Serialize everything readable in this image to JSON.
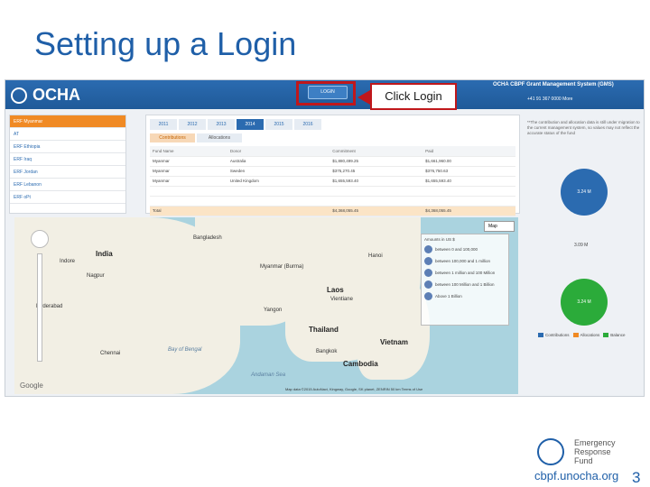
{
  "slide": {
    "title": "Setting up a Login",
    "callout": "Click Login",
    "url": "cbpf.unocha.org",
    "page_number": "3",
    "erf_lines": [
      "Emergency",
      "Response",
      "Fund"
    ]
  },
  "app": {
    "logo_text": "OCHA",
    "login_label": "LOGIN",
    "gms_title": "OCHA CBPF Grant Management System (GMS)",
    "gms_contact": "+41 91 367 0000  More"
  },
  "sidebar": {
    "items": [
      {
        "label": "ERF Myanmar"
      },
      {
        "label": "AT"
      },
      {
        "label": "ERF Ethiopia"
      },
      {
        "label": "ERF Iraq"
      },
      {
        "label": "ERF Jordan"
      },
      {
        "label": "ERF Lebanon"
      },
      {
        "label": "ERF oPt"
      }
    ]
  },
  "content": {
    "years": [
      "2011",
      "2012",
      "2013",
      "2014",
      "2015",
      "2016"
    ],
    "active_year": "2014",
    "sub_tabs": [
      "Contributions",
      "Allocations"
    ],
    "columns": [
      "Fund Name",
      "Donor",
      "Commitment",
      "Paid"
    ],
    "rows": [
      [
        "Myanmar",
        "Australia",
        "$1,880,499.25",
        "$1,661,960.00"
      ],
      [
        "Myanmar",
        "Sweden",
        "$375,270.45",
        "$376,750.63"
      ],
      [
        "Myanmar",
        "United Kingdom",
        "$1,655,593.40",
        "$1,655,593.40"
      ]
    ],
    "total_label": "Total",
    "total_commitment": "$4,368,055.45",
    "total_paid": "$4,368,055.45"
  },
  "right_panel": {
    "note": "**The contribution and allocation data is still under migration to the current management system, so values may not reflect the accurate status of the fund",
    "pie_top": "3.24 M",
    "pie_mid": "3.09 M",
    "pie_bottom": "3.24 M",
    "legend": [
      "Contributions",
      "Allocations",
      "Balance"
    ]
  },
  "map": {
    "type_label": "Map",
    "amount_title": "Amounts in US $",
    "amounts": [
      "between 0 and 100,000",
      "between 100,000 and 1 million",
      "between 1 million and 100 Million",
      "between 100 Million and 1 Billion",
      "Above 1 Billion"
    ],
    "labels": [
      "India",
      "Bangladesh",
      "Myanmar (Burma)",
      "Laos",
      "Thailand",
      "Vietnam",
      "Cambodia",
      "Bay of Bengal",
      "Andaman Sea",
      "Chennai",
      "Bangkok",
      "Yangon",
      "Hanoi",
      "Indore",
      "Nagpur",
      "Hyderabad",
      "Vientiane"
    ],
    "google": "Google",
    "footer": "Map data ©2015 AutoNavi, Kingway, Google, SK planet, ZENRIN  50 km  Terms of Use"
  }
}
